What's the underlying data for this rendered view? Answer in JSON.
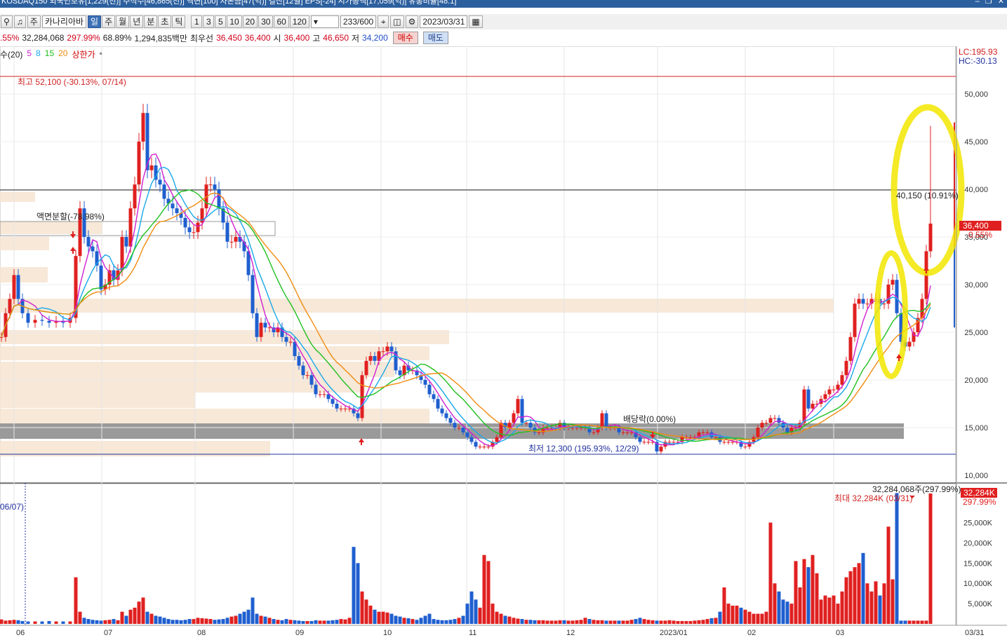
{
  "window": {
    "title": "KOSDAQ150 외국인보유[1,229(천)] 주식수[46,865(천)] 액면[100] 자본금[47(억)] 결산[12월] EPS[-24] 시가총액[17,059(억)] 유통비율[48.1]"
  },
  "toolbar": {
    "type_label": "주",
    "stock_name": "카나리아바",
    "periods": [
      "일",
      "주",
      "월",
      "년",
      "분",
      "초",
      "틱"
    ],
    "active_period": "일",
    "intervals": [
      "1",
      "3",
      "5",
      "10",
      "20",
      "30",
      "60",
      "120"
    ],
    "count": "233/600",
    "date": "2023/03/31"
  },
  "quote": {
    "change_pct": ".55%",
    "volume": "32,284,068",
    "volume_ratio": "297.99%",
    "turnover": "68.89%",
    "amount": "1,294,835백만",
    "best_label": "최우선",
    "ask": "36,450",
    "bid": "36,400",
    "open_label": "시",
    "open": "36,400",
    "high_label": "고",
    "high": "46,650",
    "low_label": "저",
    "low": "34,200",
    "buy_label": "매수",
    "sell_label": "매도"
  },
  "legend": {
    "prefix": "수(20)",
    "ma": [
      "5",
      "8",
      "15",
      "20"
    ],
    "limit_label": "상한가"
  },
  "colors": {
    "up": "#e02020",
    "down": "#1f5fcf",
    "ma5": "#d020d0",
    "ma8": "#18a8e8",
    "ma15": "#20c020",
    "ma20": "#f08c10",
    "highlight": "#f2e600",
    "vp": "#f6e6d4",
    "vp_max": "#9a9a9a"
  },
  "chart_data": {
    "type": "candlestick",
    "price_axis": {
      "ticks": [
        "50,000",
        "45,000",
        "40,000",
        "35,000",
        "30,000",
        "25,000",
        "20,000",
        "15,000",
        "10,000"
      ],
      "ylim": [
        10000,
        52000
      ]
    },
    "volume_axis": {
      "ticks": [
        "25,000K",
        "20,000K",
        "15,000K",
        "10,000K",
        "5,000K"
      ]
    },
    "x_labels": [
      "06",
      "07",
      "08",
      "09",
      "10",
      "11",
      "12",
      "2023/01",
      "02",
      "03",
      "03/31"
    ],
    "annotations": {
      "high": "최고 52,100 (-30.13%, 07/14)",
      "low": "최저 12,300 (195.93%, 12/29)",
      "split": "액면분할(-78.98%)",
      "dividend": "배당락(0.00%)",
      "hline": "40,150 (10.91%)",
      "lc": "LC:195.93",
      "hc": "HC:-30.13",
      "price_tag": "36,400",
      "price_pct": "0.55%",
      "vol_tag": "32,284K",
      "vol_pct": "297.99%",
      "vol_text": "32,284,068주(297.99%)",
      "vol_max": "최대 32,284K (03/31)",
      "vline_date": "06/07)"
    },
    "last": {
      "open": 36400,
      "high": 46650,
      "low": 34200,
      "close": 36600,
      "volume_k": 32284
    }
  }
}
